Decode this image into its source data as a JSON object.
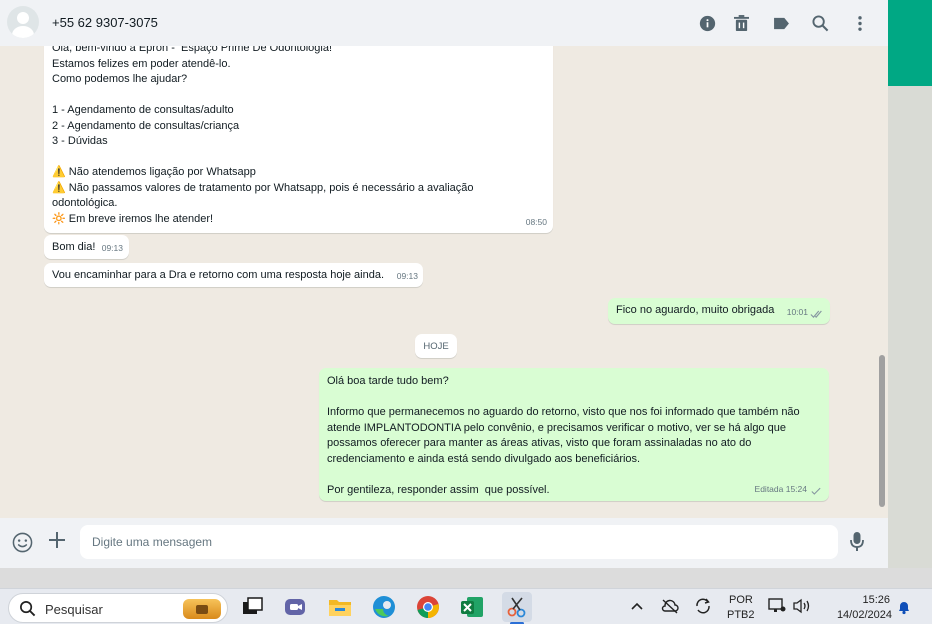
{
  "header": {
    "contact": "+55 62 9307-3075"
  },
  "messages": [
    {
      "direction": "in",
      "lines": [
        "Olá, bem-vindo à Epron -  Espaço Prime De Odontologia!",
        "Estamos felizes em poder atendê-lo.",
        "Como podemos lhe ajudar?",
        "",
        "1 - Agendamento de consultas/adulto",
        "2 - Agendamento de consultas/criança",
        "3 - Dúvidas",
        "",
        "⚠️ Não atendemos ligação por Whatsapp",
        "⚠️ Não passamos valores de tratamento por Whatsapp, pois é necessário a avaliação",
        "odontológica.",
        "🔆 Em breve iremos lhe atender!"
      ],
      "time": "08:50"
    },
    {
      "direction": "in",
      "lines": [
        "Bom dia!"
      ],
      "time": "09:13"
    },
    {
      "direction": "in",
      "lines": [
        "Vou encaminhar para a Dra e retorno com uma resposta hoje ainda."
      ],
      "time": "09:13"
    },
    {
      "direction": "out",
      "lines": [
        "Fico no aguardo, muito obrigada"
      ],
      "time": "10:01",
      "ticks": "read"
    },
    {
      "direction": "out",
      "lines": [
        "Olá boa tarde tudo bem?",
        "",
        "Informo que permanecemos no aguardo do retorno, visto que nos foi informado que também não",
        "atende IMPLANTODONTIA pelo convênio, e precisamos verificar o motivo, ver se há algo que",
        "possamos oferecer para manter as áreas ativas, visto que foram assinaladas no ato do",
        "credenciamento e ainda está sendo divulgado aos beneficiários.",
        "",
        "Por gentileza, responder assim  que possível."
      ],
      "time": "Editada 15:24",
      "ticks": "sent"
    }
  ],
  "day_chip": "HOJE",
  "composer": {
    "placeholder": "Digite uma mensagem"
  },
  "taskbar": {
    "search_label": "Pesquisar",
    "language": "POR",
    "layout": "PTB2",
    "time": "15:26",
    "date": "14/02/2024"
  },
  "colors": {
    "incoming_bubble": "#ffffff",
    "outgoing_bubble": "#d9fdd3",
    "accent": "#00a884",
    "chat_bg": "#efeae2"
  }
}
